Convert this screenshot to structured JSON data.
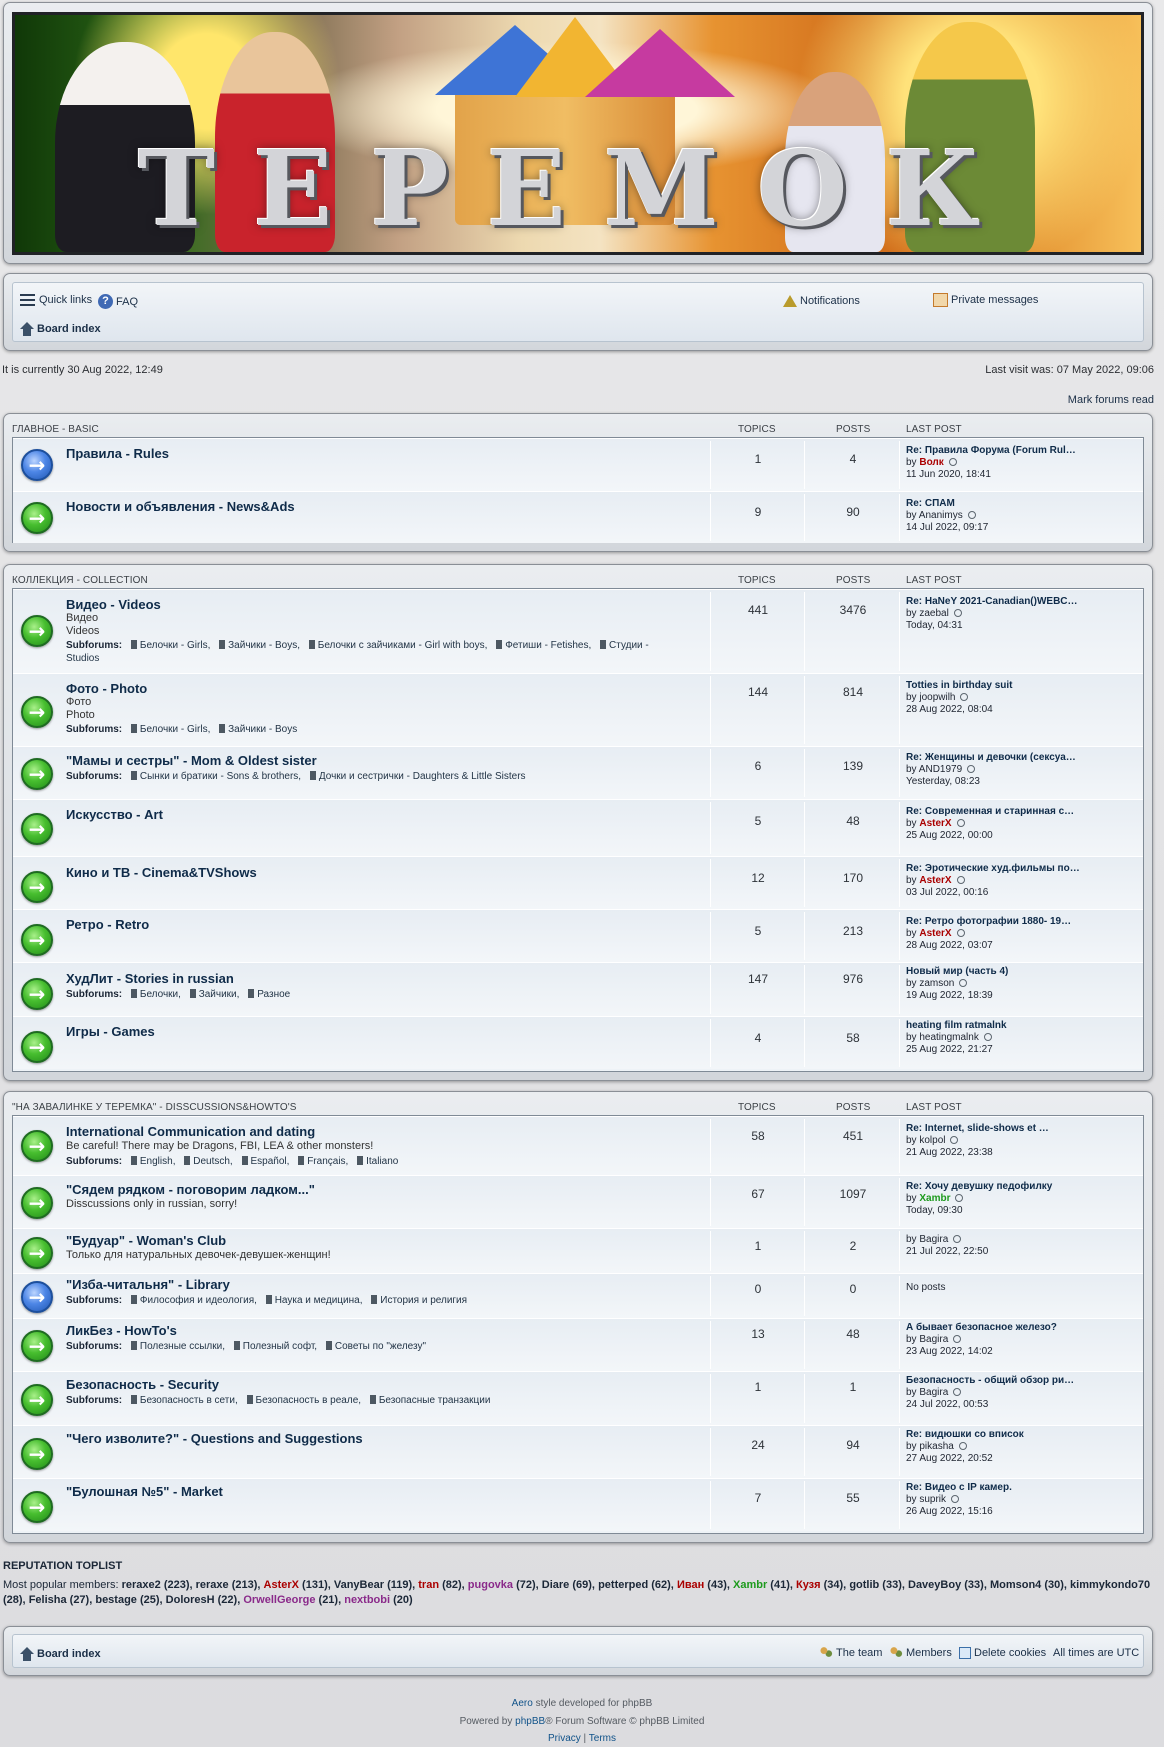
{
  "banner": {
    "title": "ТЕРЕМОК"
  },
  "nav": {
    "quick_links": "Quick links",
    "faq": "FAQ",
    "notifications": "Notifications",
    "private_messages": "Private messages",
    "board_index": "Board index"
  },
  "info": {
    "current_time": "It is currently 30 Aug 2022, 12:49",
    "last_visit": "Last visit was: 07 May 2022, 09:06",
    "mark_read": "Mark forums read"
  },
  "columns": {
    "topics": "TOPICS",
    "posts": "POSTS",
    "last_post": "LAST POST"
  },
  "sections": [
    {
      "title": "ГЛАВНОЕ - BASIC",
      "forums": [
        {
          "icon": "blue",
          "title": "Правила - Rules",
          "topics": "1",
          "posts": "4",
          "lp_title": "Re: Правила Форума (Forum Rul…",
          "lp_by": "by",
          "lp_user": "Волк",
          "lp_user_color": "red",
          "lp_time": "11 Jun 2020, 18:41"
        },
        {
          "icon": "green",
          "title": "Новости и объявления - News&Ads",
          "topics": "9",
          "posts": "90",
          "lp_title": "Re: СПАМ",
          "lp_by": "by",
          "lp_user": "Ananimys",
          "lp_user_color": "normal",
          "lp_time": "14 Jul 2022, 09:17"
        }
      ]
    },
    {
      "title": "КОЛЛЕКЦИЯ - COLLECTION",
      "forums": [
        {
          "icon": "green",
          "title": "Видео - Videos",
          "desc1": "Видео",
          "desc2": "Videos",
          "subforums_label": "Subforums:",
          "subforums": [
            "Белочки - Girls,",
            "Зайчики - Boys,",
            "Белочки с зайчиками - Girl with boys,",
            "Фетиши - Fetishes,",
            "Студии - Studios"
          ],
          "topics": "441",
          "posts": "3476",
          "lp_title": "Re: HaNeY 2021-Canadian()WEBC…",
          "lp_by": "by",
          "lp_user": "zaebal",
          "lp_user_color": "normal",
          "lp_time": "Today, 04:31"
        },
        {
          "icon": "green",
          "title": "Фото - Photo",
          "desc1": "Фото",
          "desc2": "Photo",
          "subforums_label": "Subforums:",
          "subforums": [
            "Белочки - Girls,",
            "Зайчики - Boys"
          ],
          "topics": "144",
          "posts": "814",
          "lp_title": "Totties in birthday suit",
          "lp_by": "by",
          "lp_user": "joopwilh",
          "lp_user_color": "normal",
          "lp_time": "28 Aug 2022, 08:04"
        },
        {
          "icon": "green",
          "title": "\"Мамы и сестры\" - Mom & Oldest sister",
          "subforums_label": "Subforums:",
          "subforums": [
            "Сынки и братики - Sons & brothers,",
            "Дочки и сестрички - Daughters & Little Sisters"
          ],
          "topics": "6",
          "posts": "139",
          "lp_title": "Re: Женщины и девочки (сексуа…",
          "lp_by": "by",
          "lp_user": "AND1979",
          "lp_user_color": "normal",
          "lp_time": "Yesterday, 08:23"
        },
        {
          "icon": "green",
          "title": "Искусство - Art",
          "topics": "5",
          "posts": "48",
          "lp_title": "Re: Современная и старинная с…",
          "lp_by": "by",
          "lp_user": "AsterX",
          "lp_user_color": "red",
          "lp_time": "25 Aug 2022, 00:00"
        },
        {
          "icon": "green",
          "title": "Кино и ТВ - Cinema&TVShows",
          "topics": "12",
          "posts": "170",
          "lp_title": "Re: Эротические худ.фильмы по…",
          "lp_by": "by",
          "lp_user": "AsterX",
          "lp_user_color": "red",
          "lp_time": "03 Jul 2022, 00:16"
        },
        {
          "icon": "green",
          "title": "Ретро - Retro",
          "topics": "5",
          "posts": "213",
          "lp_title": "Re: Ретро фотографии 1880- 19…",
          "lp_by": "by",
          "lp_user": "AsterX",
          "lp_user_color": "red",
          "lp_time": "28 Aug 2022, 03:07"
        },
        {
          "icon": "green",
          "title": "ХудЛит - Stories in russian",
          "subforums_label": "Subforums:",
          "subforums": [
            "Белочки,",
            "Зайчики,",
            "Разное"
          ],
          "topics": "147",
          "posts": "976",
          "lp_title": "Новый мир (часть 4)",
          "lp_by": "by",
          "lp_user": "zamson",
          "lp_user_color": "normal",
          "lp_time": "19 Aug 2022, 18:39"
        },
        {
          "icon": "green",
          "title": "Игры - Games",
          "topics": "4",
          "posts": "58",
          "lp_title": "heating film ratmalnk",
          "lp_by": "by",
          "lp_user": "heatingmalnk",
          "lp_user_color": "normal",
          "lp_time": "25 Aug 2022, 21:27"
        }
      ]
    },
    {
      "title": "\"НА ЗАВАЛИНКЕ У ТЕРЕМКА\" - DISSCUSSIONS&HOWTO'S",
      "forums": [
        {
          "icon": "green",
          "title": "International Communication and dating",
          "desc1": "Be careful! There may be Dragons, FBI, LEA & other monsters!",
          "subforums_label": "Subforums:",
          "subforums": [
            "English,",
            "Deutsch,",
            "Español,",
            "Français,",
            "Italiano"
          ],
          "topics": "58",
          "posts": "451",
          "lp_title": "Re: Internet, slide-shows et …",
          "lp_by": "by",
          "lp_user": "kolpol",
          "lp_user_color": "normal",
          "lp_time": "21 Aug 2022, 23:38"
        },
        {
          "icon": "green",
          "title": "\"Сядем рядком - поговорим ладком...\"",
          "desc1": "Disscussions only in russian, sorry!",
          "topics": "67",
          "posts": "1097",
          "lp_title": "Re: Хочу девушку педофилку",
          "lp_by": "by",
          "lp_user": "Xambr",
          "lp_user_color": "green",
          "lp_time": "Today, 09:30"
        },
        {
          "icon": "green",
          "title": "\"Будуар\" - Woman's Club",
          "desc1": "Только для натуральных девочек-девушек-женщин!",
          "topics": "1",
          "posts": "2",
          "lp_title": "",
          "lp_by": "by",
          "lp_user": "Bagira",
          "lp_user_color": "normal",
          "lp_time": "21 Jul 2022, 22:50"
        },
        {
          "icon": "blue",
          "title": "\"Изба-читальня\" - Library",
          "subforums_label": "Subforums:",
          "subforums": [
            "Философия и идеология,",
            "Наука и медицина,",
            "История и религия"
          ],
          "topics": "0",
          "posts": "0",
          "lp_nopost": "No posts"
        },
        {
          "icon": "green",
          "title": "ЛикБез - HowTo's",
          "subforums_label": "Subforums:",
          "subforums": [
            "Полезные ссылки,",
            "Полезный софт,",
            "Советы по \"железу\""
          ],
          "topics": "13",
          "posts": "48",
          "lp_title": "А бывает безопасное железо?",
          "lp_by": "by",
          "lp_user": "Bagira",
          "lp_user_color": "normal",
          "lp_time": "23 Aug 2022, 14:02"
        },
        {
          "icon": "green",
          "title": "Безопасность - Security",
          "subforums_label": "Subforums:",
          "subforums": [
            "Безопасность в сети,",
            "Безопасность в реале,",
            "Безопасные транзакции"
          ],
          "topics": "1",
          "posts": "1",
          "lp_title": "Безопасность - общий обзор ри…",
          "lp_by": "by",
          "lp_user": "Bagira",
          "lp_user_color": "normal",
          "lp_time": "24 Jul 2022, 00:53"
        },
        {
          "icon": "green",
          "title": "\"Чего изволите?\" - Questions and Suggestions",
          "topics": "24",
          "posts": "94",
          "lp_title": "Re: видюшки со вписок",
          "lp_by": "by",
          "lp_user": "pikasha",
          "lp_user_color": "normal",
          "lp_time": "27 Aug 2022, 20:52"
        },
        {
          "icon": "green",
          "title": "\"Булошная №5\" - Market",
          "topics": "7",
          "posts": "55",
          "lp_title": "Re: Видео с IP камер.",
          "lp_by": "by",
          "lp_user": "suprik",
          "lp_user_color": "normal",
          "lp_time": "26 Aug 2022, 15:16"
        }
      ]
    }
  ],
  "reputation": {
    "title": "REPUTATION TOPLIST",
    "label": "Most popular members:",
    "members": [
      {
        "name": "reraxe2",
        "count": "(223)",
        "color": "#1b2737"
      },
      {
        "name": "reraxe",
        "count": "(213)",
        "color": "#1b2737"
      },
      {
        "name": "AsterX",
        "count": "(131)",
        "color": "#aa0000"
      },
      {
        "name": "VanyBear",
        "count": "(119)",
        "color": "#1b2737"
      },
      {
        "name": "tran",
        "count": "(82)",
        "color": "#aa0000"
      },
      {
        "name": "pugovka",
        "count": "(72)",
        "color": "#8a2a8a"
      },
      {
        "name": "Diare",
        "count": "(69)",
        "color": "#1b2737"
      },
      {
        "name": "petterped",
        "count": "(62)",
        "color": "#1b2737"
      },
      {
        "name": "Иван",
        "count": "(43)",
        "color": "#aa0000"
      },
      {
        "name": "Xambr",
        "count": "(41)",
        "color": "#1d9a1d"
      },
      {
        "name": "Кузя",
        "count": "(34)",
        "color": "#aa0000"
      },
      {
        "name": "gotlib",
        "count": "(33)",
        "color": "#1b2737"
      },
      {
        "name": "DaveyBoy",
        "count": "(33)",
        "color": "#1b2737"
      },
      {
        "name": "Momson4",
        "count": "(30)",
        "color": "#1b2737"
      },
      {
        "name": "kimmykondo70",
        "count": "(28)",
        "color": "#1b2737"
      },
      {
        "name": "Felisha",
        "count": "(27)",
        "color": "#1b2737"
      },
      {
        "name": "bestage",
        "count": "(25)",
        "color": "#1b2737"
      },
      {
        "name": "DoloresH",
        "count": "(22)",
        "color": "#1b2737"
      },
      {
        "name": "OrwellGeorge",
        "count": "(21)",
        "color": "#8a2a8a"
      },
      {
        "name": "nextbobi",
        "count": "(20)",
        "color": "#8a2a8a"
      }
    ]
  },
  "footer": {
    "board_index": "Board index",
    "team": "The team",
    "members": "Members",
    "delete_cookies": "Delete cookies",
    "timezone": "All times are UTC",
    "style_pre": "Aero",
    "style_post": " style developed for phpBB",
    "powered_pre": "Powered by ",
    "powered_link": "phpBB",
    "powered_post": "® Forum Software © phpBB Limited",
    "privacy": "Privacy",
    "pipe": " | ",
    "terms": "Terms"
  }
}
